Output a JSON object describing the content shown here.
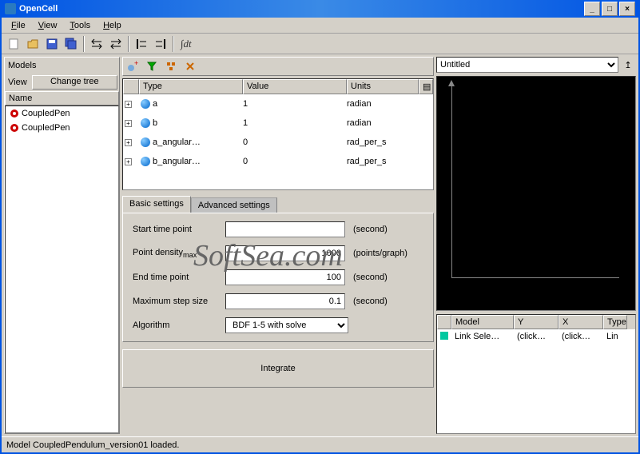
{
  "title": "OpenCell",
  "menus": {
    "file": "File",
    "view": "View",
    "tools": "Tools",
    "help": "Help"
  },
  "toolbar_op": "∫dt",
  "left_panel": {
    "models": "Models",
    "view": "View",
    "change_tree": "Change tree",
    "name_hdr": "Name",
    "items": [
      "CoupledPen",
      "CoupledPen"
    ]
  },
  "var_table": {
    "headers": {
      "type": "Type",
      "value": "Value",
      "units": "Units"
    },
    "rows": [
      {
        "name": "a",
        "value": "1",
        "units": "radian"
      },
      {
        "name": "b",
        "value": "1",
        "units": "radian"
      },
      {
        "name": "a_angular…",
        "value": "0",
        "units": "rad_per_s"
      },
      {
        "name": "b_angular…",
        "value": "0",
        "units": "rad_per_s"
      }
    ]
  },
  "tabs": {
    "basic": "Basic settings",
    "advanced": "Advanced settings"
  },
  "settings": {
    "start_label": "Start time point",
    "start_val": "",
    "start_unit": "(second)",
    "density_label": "Point density",
    "density_sub": "max",
    "density_val": "1000",
    "density_unit": "(points/graph)",
    "end_label": "End time point",
    "end_val": "100",
    "end_unit": "(second)",
    "maxstep_label": "Maximum step size",
    "maxstep_val": "0.1",
    "maxstep_unit": "(second)",
    "algo_label": "Algorithm",
    "algo_val": "BDF 1-5 with solve"
  },
  "integrate": "Integrate",
  "right": {
    "dropdown": "Untitled",
    "list_headers": {
      "model": "Model",
      "y": "Y",
      "x": "X",
      "type": "Type"
    },
    "list_row": {
      "model": "Link Sele…",
      "y": "(click…",
      "x": "(click…",
      "type": "Lin"
    }
  },
  "status": "Model CoupledPendulum_version01 loaded.",
  "watermark": "SoftSea.com"
}
